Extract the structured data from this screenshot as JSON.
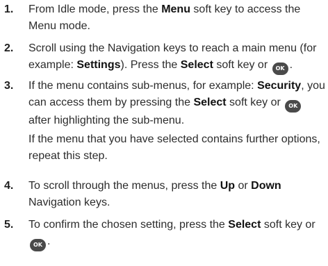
{
  "steps": [
    {
      "number": "1.",
      "parts": [
        "From Idle mode, press the ",
        "Menu",
        " soft key to access the Menu mode."
      ]
    },
    {
      "number": "2.",
      "parts": [
        "Scroll using the Navigation keys to reach a main menu (for example: ",
        "Settings",
        "). Press the ",
        "Select",
        " soft key or ",
        "."
      ]
    },
    {
      "number": "3.",
      "parts": [
        "If the menu contains sub-menus, for example: ",
        "Security",
        ", you can access them by pressing the ",
        "Select",
        " soft key or ",
        " after highlighting the sub-menu."
      ],
      "note": "If the menu that you have selected contains further options, repeat this step."
    },
    {
      "number": "4.",
      "parts": [
        "To scroll through the menus, press the ",
        "Up",
        " or ",
        "Down",
        " Navigation keys."
      ]
    },
    {
      "number": "5.",
      "parts": [
        "To confirm the chosen setting, press the ",
        "Select",
        " soft key or ",
        "."
      ]
    }
  ],
  "ok_key": {
    "label": "OK",
    "icon": "ok-key-icon",
    "color": "#4a4a4a"
  }
}
